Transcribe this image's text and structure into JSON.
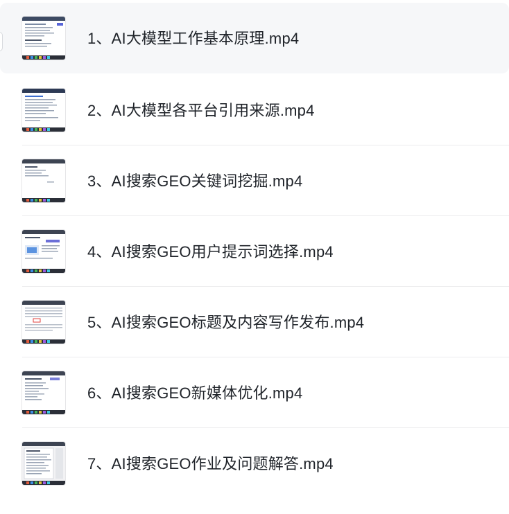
{
  "files": [
    {
      "name": "1、AI大模型工作基本原理.mp4",
      "selected": true
    },
    {
      "name": "2、AI大模型各平台引用来源.mp4",
      "selected": false
    },
    {
      "name": "3、AI搜索GEO关键词挖掘.mp4",
      "selected": false
    },
    {
      "name": "4、AI搜索GEO用户提示词选择.mp4",
      "selected": false
    },
    {
      "name": "5、AI搜索GEO标题及内容写作发布.mp4",
      "selected": false
    },
    {
      "name": "6、AI搜索GEO新媒体优化.mp4",
      "selected": false
    },
    {
      "name": "7、AI搜索GEO作业及问题解答.mp4",
      "selected": false
    }
  ]
}
